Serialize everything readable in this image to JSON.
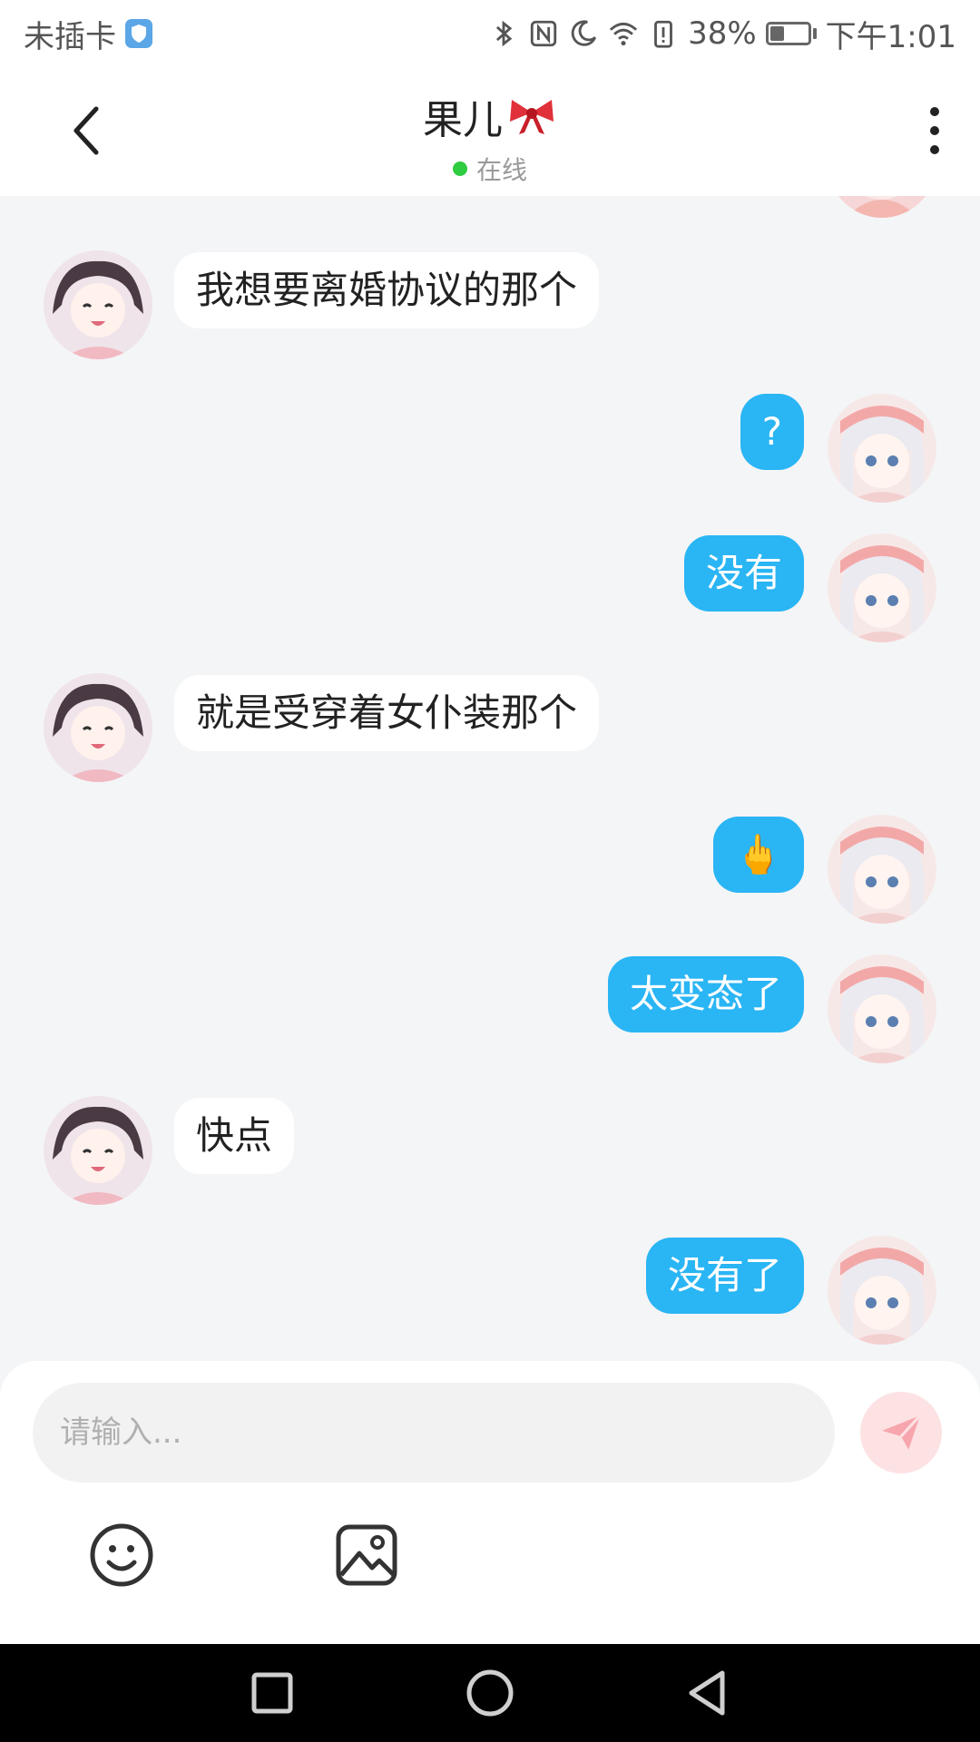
{
  "status_bar": {
    "carrier": "未插卡",
    "battery_percent": "38%",
    "battery_level": 0.38,
    "time": "下午1:01",
    "icons": [
      "shield-icon",
      "bluetooth-icon",
      "nfc-icon",
      "moon-icon",
      "wifi-icon",
      "battery-alert-icon",
      "battery-icon"
    ]
  },
  "header": {
    "title": "果儿",
    "title_icon": "ribbon-bow-icon",
    "presence": "在线",
    "presence_color": "#2ecc40"
  },
  "messages": [
    {
      "side": "in",
      "text": "我想要离婚协议的那个"
    },
    {
      "side": "out",
      "text": "?"
    },
    {
      "side": "out",
      "text": "没有"
    },
    {
      "side": "in",
      "text": "就是受穿着女仆装那个"
    },
    {
      "side": "out",
      "text": "🖕"
    },
    {
      "side": "out",
      "text": "太变态了"
    },
    {
      "side": "in",
      "text": "快点"
    },
    {
      "side": "out",
      "text": "没有了"
    }
  ],
  "composer": {
    "placeholder": "请输入...",
    "send_icon": "send-icon",
    "tools": [
      "emoji-icon",
      "image-icon"
    ]
  },
  "colors": {
    "outgoing_bubble": "#2ab5f4",
    "incoming_bubble": "#ffffff",
    "background": "#f4f5f7"
  },
  "nav_bar": {
    "buttons": [
      "recent-apps-icon",
      "home-icon",
      "back-icon"
    ]
  }
}
